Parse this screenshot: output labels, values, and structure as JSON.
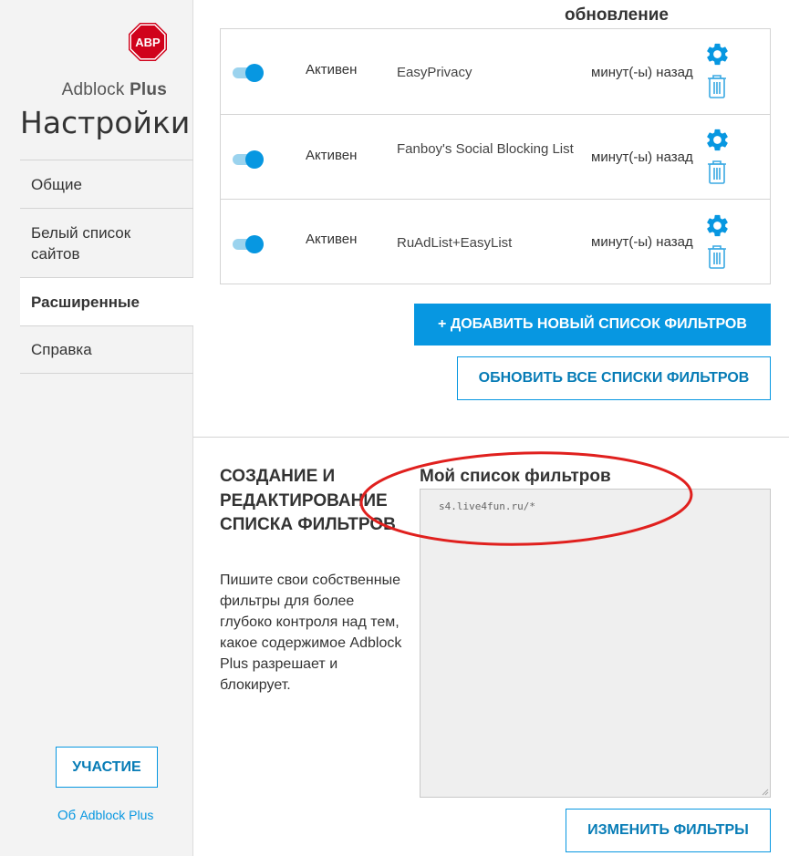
{
  "sidebar": {
    "logo_text": "ABP",
    "brand_prefix": "Adblock ",
    "brand_bold": "Plus",
    "title": "Настройки",
    "nav": [
      {
        "label": "Общие"
      },
      {
        "label": "Белый список сайтов"
      },
      {
        "label": "Расширенные"
      },
      {
        "label": "Справка"
      }
    ],
    "contribute_label": "УЧАСТИЕ",
    "about_prefix": "Об ",
    "about_brand": "Adblock Plus"
  },
  "filter_lists": {
    "column_header_updated": "обновление",
    "rows": [
      {
        "status": "Активен",
        "name": "EasyPrivacy",
        "updated": "минут(-ы) назад"
      },
      {
        "status": "Активен",
        "name": "Fanboy's Social Blocking List",
        "updated": "минут(-ы) назад"
      },
      {
        "status": "Активен",
        "name": "RuAdList+EasyList",
        "updated": "минут(-ы) назад"
      }
    ],
    "add_button": "+ ДОБАВИТЬ НОВЫЙ СПИСОК ФИЛЬТРОВ",
    "update_button": "ОБНОВИТЬ ВСЕ СПИСКИ ФИЛЬТРОВ"
  },
  "custom_filters": {
    "section_title": "СОЗДАНИЕ И РЕДАКТИРОВАНИЕ СПИСКА ФИЛЬТРОВ",
    "description": "Пишите свои собственные фильтры для более глубоко контроля над тем, какое содержимое Adblock Plus разрешает и блокирует.",
    "my_list_title": "Мой список фильтров",
    "filter_text": "s4.live4fun.ru/*",
    "edit_button": "ИЗМЕНИТЬ ФИЛЬТРЫ"
  },
  "colors": {
    "accent": "#0797e1",
    "accent_dark": "#077cb6",
    "toggle_track": "#9bd3ee",
    "logo_red": "#d0021b",
    "annotation_red": "#e0201e",
    "sidebar_bg": "#f3f3f3"
  },
  "icons": {
    "logo": "abp-stop-sign-icon",
    "gear": "gear-icon",
    "trash": "trash-icon"
  }
}
